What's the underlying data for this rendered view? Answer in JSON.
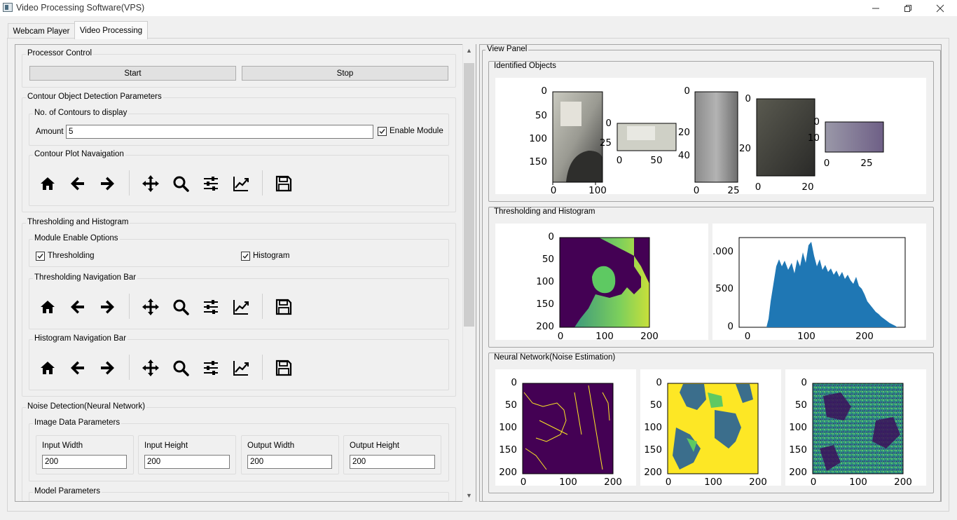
{
  "window": {
    "title": "Video Processing Software(VPS)",
    "minimize_icon": "minimize-icon",
    "maximize_icon": "restore-icon",
    "close_icon": "close-icon"
  },
  "tabs": [
    {
      "label": "Webcam Player",
      "active": false
    },
    {
      "label": "Video Processing",
      "active": true
    }
  ],
  "processor_control": {
    "title": "Processor Control",
    "start_label": "Start",
    "stop_label": "Stop"
  },
  "contour": {
    "title": "Contour Object Detection Parameters",
    "count_group_title": "No. of Contours to display",
    "amount_label": "Amount",
    "amount_value": "5",
    "enable_label": "Enable Module",
    "enable_checked": true,
    "nav_title": "Contour Plot Navaigation"
  },
  "threshold_hist": {
    "title": "Thresholding and Histogram",
    "enable_group_title": "Module Enable Options",
    "thresholding_label": "Thresholding",
    "thresholding_checked": true,
    "histogram_label": "Histogram",
    "histogram_checked": true,
    "thresh_nav_title": "Thresholding Navigation Bar",
    "hist_nav_title": "Histogram Navigation Bar"
  },
  "toolbar_icons": [
    "home-icon",
    "back-arrow-icon",
    "forward-arrow-icon",
    "pan-icon",
    "zoom-icon",
    "configure-subplots-icon",
    "edit-axis-icon",
    "save-icon"
  ],
  "noise": {
    "title": "Noise Detection(Neural Network)",
    "image_params_title": "Image Data Parameters",
    "fields": [
      {
        "label": "Input Width",
        "value": "200"
      },
      {
        "label": "Input Height",
        "value": "200"
      },
      {
        "label": "Output Width",
        "value": "200"
      },
      {
        "label": "Output Height",
        "value": "200"
      }
    ],
    "model_params_title": "Model Parameters"
  },
  "view_panel": {
    "title": "View Panel",
    "identified_title": "Identified Objects",
    "thresh_title": "Thresholding and Histogram",
    "neural_title": "Neural Network(Noise Estimation)"
  },
  "colors": {
    "viridis_dark": "#440154",
    "viridis_mid": "#21908d",
    "viridis_yellow": "#fde725",
    "hist_blue": "#1f77b4"
  },
  "axes": {
    "obj1_y": [
      "0",
      "50",
      "100",
      "150"
    ],
    "obj1_x": [
      "0",
      "100"
    ],
    "obj2_y": [
      "0",
      "25"
    ],
    "obj2_x": [
      "0",
      "50"
    ],
    "obj3_y": [
      "0",
      "20",
      "40"
    ],
    "obj3_x": [
      "0",
      "25"
    ],
    "obj4_y": [
      "0",
      "20"
    ],
    "obj4_x": [
      "0",
      "20"
    ],
    "obj5_y": [
      "0",
      "10"
    ],
    "obj5_x": [
      "0",
      "25"
    ],
    "img_y": [
      "0",
      "50",
      "100",
      "150",
      "200"
    ],
    "img_x": [
      "0",
      "100",
      "200"
    ],
    "hist_y": [
      ".000",
      "500",
      "0"
    ],
    "hist_x": [
      "0",
      "100",
      "200"
    ]
  }
}
